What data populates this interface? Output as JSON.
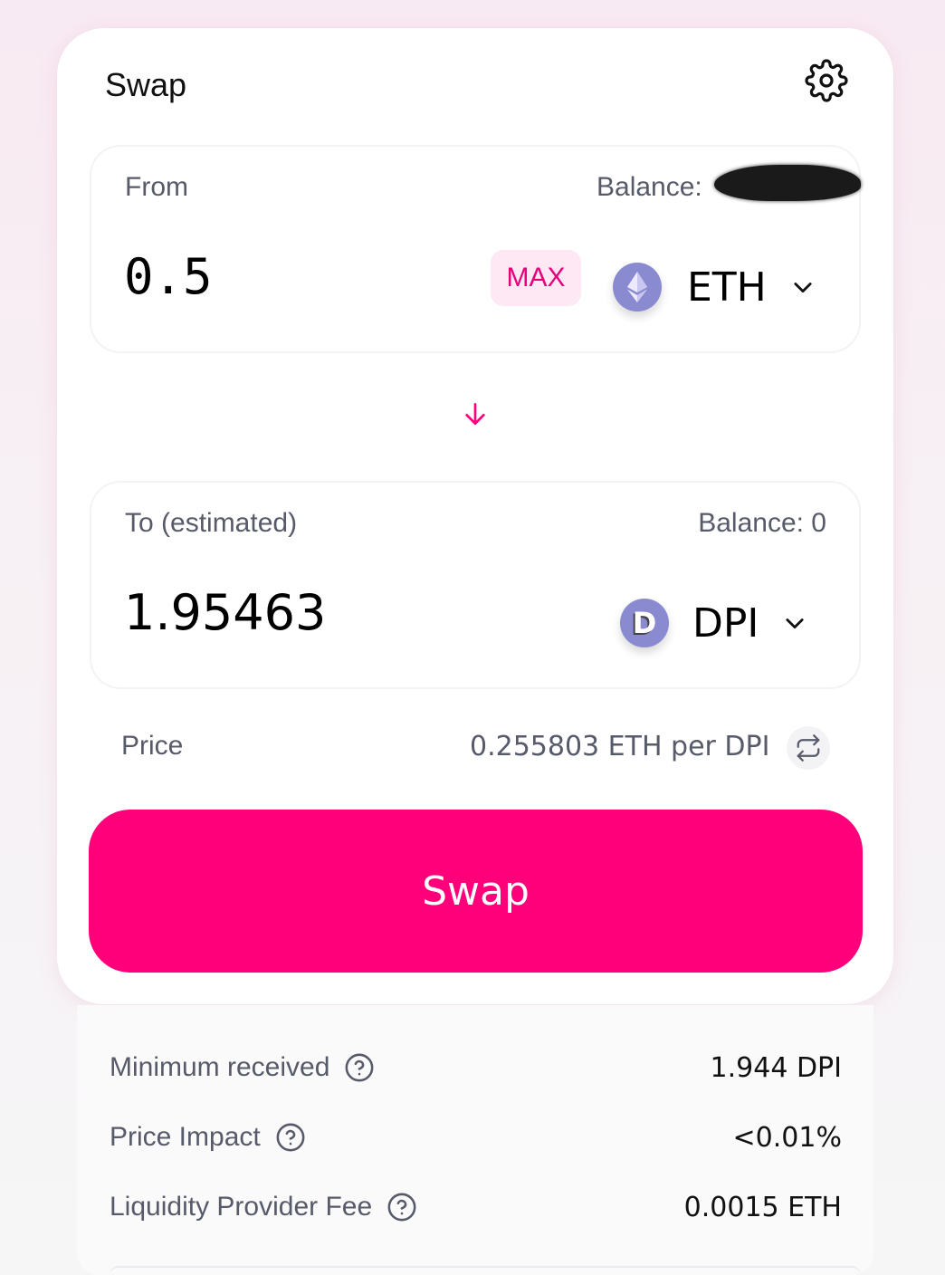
{
  "card": {
    "title": "Swap"
  },
  "from": {
    "label": "From",
    "balance_label": "Balance:",
    "amount": "0.5",
    "max_label": "MAX",
    "token": "ETH"
  },
  "to": {
    "label": "To (estimated)",
    "balance_label": "Balance: 0",
    "amount": "1.95463",
    "token": "DPI",
    "token_icon_letter": "D"
  },
  "price": {
    "label": "Price",
    "value": "0.255803 ETH per DPI"
  },
  "swap_button_label": "Swap",
  "details": [
    {
      "label": "Minimum received",
      "value": "1.944 DPI"
    },
    {
      "label": "Price Impact",
      "value": "<0.01%"
    },
    {
      "label": "Liquidity Provider Fee",
      "value": "0.0015 ETH"
    }
  ],
  "colors": {
    "accent": "#ff007a",
    "max_bg": "#fde8f3",
    "muted_text": "#565a69",
    "token_icon_bg": "#8a8ad0"
  },
  "icons": [
    "gear-icon",
    "eth-icon",
    "chevron-down-icon",
    "arrow-down-icon",
    "dpi-icon",
    "swap-rate-icon",
    "question-icon"
  ]
}
